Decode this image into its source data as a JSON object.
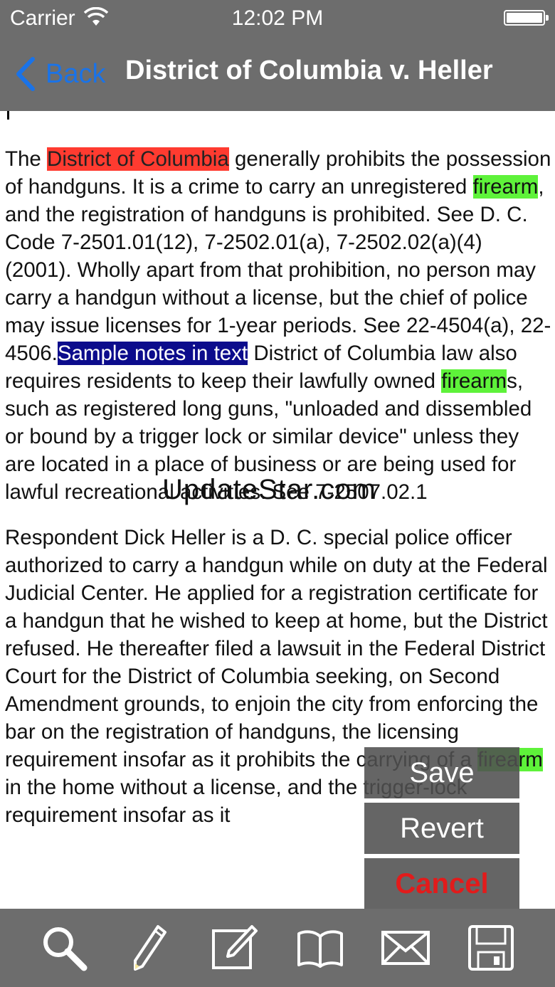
{
  "status_bar": {
    "carrier": "Carrier",
    "time": "12:02 PM"
  },
  "nav": {
    "back_label": "Back",
    "title": "District of Columbia v. Heller"
  },
  "document": {
    "p1": {
      "s1": "The ",
      "h1": "District of Columbia",
      "s2": " generally prohibits the possession of handguns. It is a crime to carry an unregistered ",
      "h2": "firearm",
      "s3": ", and the registration of handguns is prohibited. See D. C. Code 7-2501.01(12), 7-2502.01(a), 7-2502.02(a)(4) (2001). Wholly apart from that prohibition, no person may carry a handgun without a license, but the chief of police may issue licenses for 1-year periods. See 22-4504(a), 22-4506.",
      "h3": "Sample notes in text",
      "s4": " District of Columbia law also requires residents to keep their lawfully owned ",
      "h4": "firearm",
      "s5": "s, such as registered long guns, \"unloaded and dissembled or bound by a trigger lock or similar device\" unless they are located in a place of business or are being used for lawful recreational activities. See 7-2507.02.1"
    },
    "p2": {
      "s1": "Respondent Dick Heller is a D. C. special police officer authorized to carry a handgun while on duty at the Federal Judicial Center. He applied for a registration certificate for a handgun that he wished to keep at home, but the District refused. He thereafter filed a lawsuit in the Federal District Court for the District of Columbia seeking, on Second Amendment grounds, to enjoin the city from enforcing the bar on the registration of handguns, the licensing requirement insofar as it prohibits the carrying of a ",
      "h1": "firearm",
      "s2": " in the home without a license, and the trigger-lock requirement insofar as it"
    }
  },
  "watermark": "UpdateStar.com",
  "menu": {
    "save": "Save",
    "revert": "Revert",
    "cancel": "Cancel"
  },
  "toolbar": {
    "icons": [
      "search-icon",
      "pencil-icon",
      "edit-note-icon",
      "book-icon",
      "mail-icon",
      "save-disk-icon"
    ]
  },
  "colors": {
    "bar_gray": "#6d6d6d",
    "back_blue": "#1a73e8",
    "highlight_red": "#ff3b30",
    "highlight_green": "#5ef23a",
    "highlight_blue": "#0c0c8c",
    "cancel_red": "#e21b1b"
  }
}
